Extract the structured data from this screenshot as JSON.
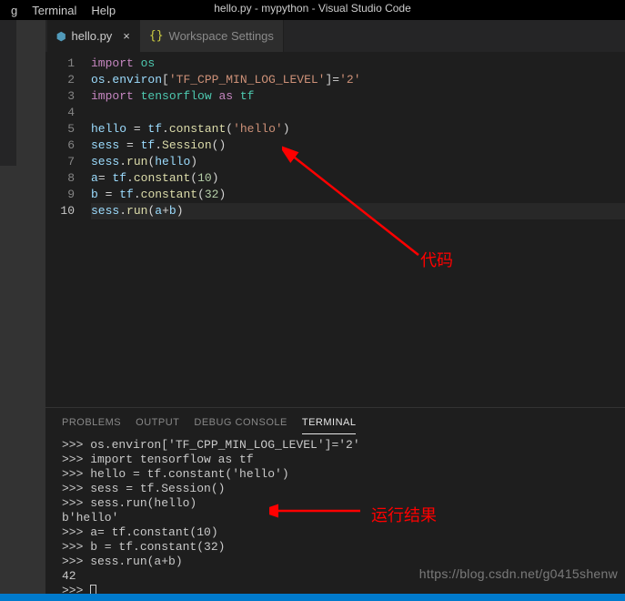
{
  "menu": {
    "items": [
      "g",
      "Terminal",
      "Help"
    ]
  },
  "window_title": "hello.py - mypython - Visual Studio Code",
  "tabs": [
    {
      "icon": "python",
      "label": "hello.py",
      "active": true,
      "dirty": false
    },
    {
      "icon": "json",
      "label": "Workspace Settings",
      "active": false,
      "dirty": false
    }
  ],
  "editor": {
    "lines": [
      [
        [
          "kw",
          "import"
        ],
        [
          "op",
          " "
        ],
        [
          "mod",
          "os"
        ]
      ],
      [
        [
          "var",
          "os"
        ],
        [
          "op",
          "."
        ],
        [
          "var",
          "environ"
        ],
        [
          "op",
          "["
        ],
        [
          "str",
          "'TF_CPP_MIN_LOG_LEVEL'"
        ],
        [
          "op",
          "]="
        ],
        [
          "str",
          "'2'"
        ]
      ],
      [
        [
          "kw",
          "import"
        ],
        [
          "op",
          " "
        ],
        [
          "mod",
          "tensorflow"
        ],
        [
          "op",
          " "
        ],
        [
          "kw",
          "as"
        ],
        [
          "op",
          " "
        ],
        [
          "mod",
          "tf"
        ]
      ],
      [],
      [
        [
          "var",
          "hello"
        ],
        [
          "op",
          " = "
        ],
        [
          "var",
          "tf"
        ],
        [
          "op",
          "."
        ],
        [
          "fn",
          "constant"
        ],
        [
          "op",
          "("
        ],
        [
          "str",
          "'hello'"
        ],
        [
          "op",
          ")"
        ]
      ],
      [
        [
          "var",
          "sess"
        ],
        [
          "op",
          " = "
        ],
        [
          "var",
          "tf"
        ],
        [
          "op",
          "."
        ],
        [
          "fn",
          "Session"
        ],
        [
          "op",
          "()"
        ]
      ],
      [
        [
          "var",
          "sess"
        ],
        [
          "op",
          "."
        ],
        [
          "fn",
          "run"
        ],
        [
          "op",
          "("
        ],
        [
          "var",
          "hello"
        ],
        [
          "op",
          ")"
        ]
      ],
      [
        [
          "var",
          "a"
        ],
        [
          "op",
          "= "
        ],
        [
          "var",
          "tf"
        ],
        [
          "op",
          "."
        ],
        [
          "fn",
          "constant"
        ],
        [
          "op",
          "("
        ],
        [
          "num",
          "10"
        ],
        [
          "op",
          ")"
        ]
      ],
      [
        [
          "var",
          "b"
        ],
        [
          "op",
          " = "
        ],
        [
          "var",
          "tf"
        ],
        [
          "op",
          "."
        ],
        [
          "fn",
          "constant"
        ],
        [
          "op",
          "("
        ],
        [
          "num",
          "32"
        ],
        [
          "op",
          ")"
        ]
      ],
      [
        [
          "var",
          "sess"
        ],
        [
          "op",
          "."
        ],
        [
          "fn",
          "run"
        ],
        [
          "op",
          "("
        ],
        [
          "var",
          "a"
        ],
        [
          "op",
          "+"
        ],
        [
          "var",
          "b"
        ],
        [
          "op",
          ")"
        ]
      ]
    ],
    "active_line": 10
  },
  "panel": {
    "tabs": [
      "PROBLEMS",
      "OUTPUT",
      "DEBUG CONSOLE",
      "TERMINAL"
    ],
    "active": 3,
    "terminal_lines": [
      ">>> os.environ['TF_CPP_MIN_LOG_LEVEL']='2'",
      ">>> import tensorflow as tf",
      ">>> hello = tf.constant('hello')",
      ">>> sess = tf.Session()",
      ">>> sess.run(hello)",
      "b'hello'",
      ">>> a= tf.constant(10)",
      ">>> b = tf.constant(32)",
      ">>> sess.run(a+b)",
      "42",
      ">>> "
    ]
  },
  "annotations": {
    "code_label": "代码",
    "result_label": "运行结果"
  },
  "watermark": "https://blog.csdn.net/g0415shenw"
}
